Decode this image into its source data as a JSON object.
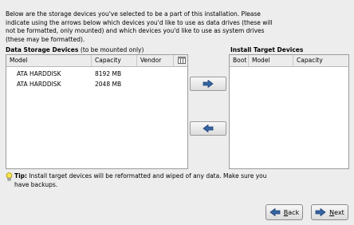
{
  "intro_text": "Below are the storage devices you've selected to be a part of this installation.  Please indicate using the arrows below which devices you'd like to use as data drives (these will not be formatted, only mounted) and which devices you'd like to use as system drives (these may be formatted).",
  "data_storage": {
    "heading": "Data Storage Devices",
    "subheading": "(to be mounted only)",
    "columns": [
      "Model",
      "Capacity",
      "Vendor"
    ],
    "rows": [
      {
        "model": "ATA HARDDISK",
        "capacity": "8192 MB",
        "vendor": ""
      },
      {
        "model": "ATA HARDDISK",
        "capacity": "2048 MB",
        "vendor": ""
      }
    ]
  },
  "install_target": {
    "heading": "Install Target Devices",
    "columns": [
      "Boot",
      "Model",
      "Capacity"
    ]
  },
  "tip": {
    "label": "Tip:",
    "text": " Install target devices will be reformatted and wiped of any data.  Make sure you have backups."
  },
  "nav": {
    "back_label": "Back",
    "back_mnemonic": "B",
    "back_rest": "ack",
    "next_label": "Next",
    "next_mnemonic": "N",
    "next_rest": "ext"
  },
  "colors": {
    "arrow": "#3465a4",
    "background": "#ededed"
  },
  "icons": {
    "add": "right-arrow-icon",
    "remove": "left-arrow-icon",
    "tip": "lightbulb-icon",
    "back": "back-arrow-icon",
    "next": "next-arrow-icon",
    "columns": "column-chooser-icon"
  }
}
